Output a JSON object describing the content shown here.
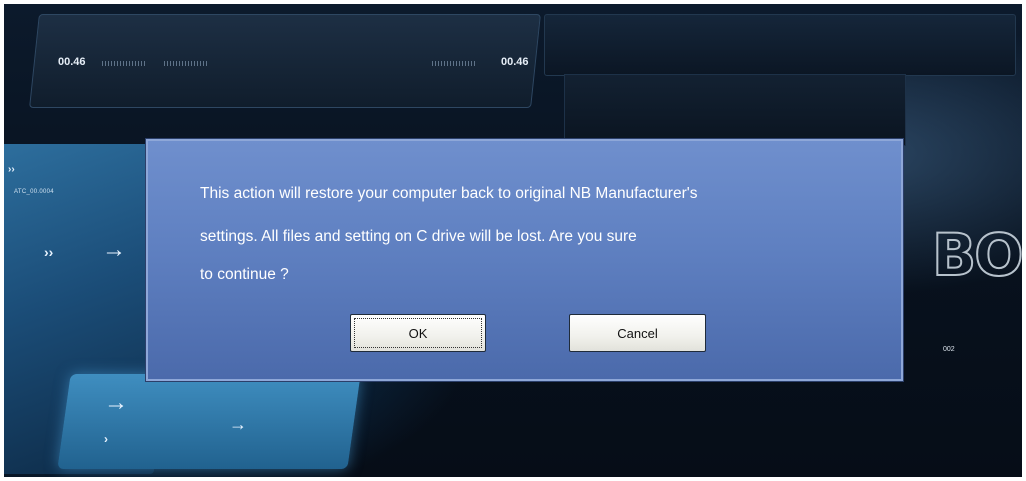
{
  "background": {
    "time_left": "00.46",
    "time_right": "00.46",
    "side_label": "ATC_00.0004",
    "logo_text": "BO",
    "small_number": "002"
  },
  "dialog": {
    "message_lines": [
      "This action will restore your computer back to original NB Manufacturer's",
      "settings. All files and setting on C drive will be lost. Are you sure",
      "to continue ?"
    ],
    "ok_label": "OK",
    "cancel_label": "Cancel"
  },
  "colors": {
    "dialog_top": "#6f8fcd",
    "dialog_bottom": "#4b6aab",
    "dialog_border": "#8ea7d8",
    "background_dark": "#08121f"
  }
}
